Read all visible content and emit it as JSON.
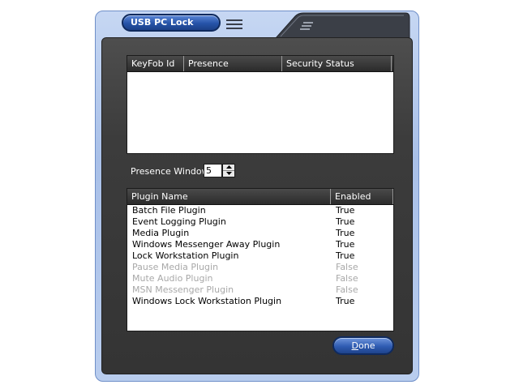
{
  "window": {
    "title": "USB PC Lock"
  },
  "keyfob_table": {
    "columns": [
      "KeyFob Id",
      "Presence",
      "Security Status"
    ],
    "rows": []
  },
  "presence": {
    "label": "Presence Window",
    "value": "5"
  },
  "plugin_table": {
    "columns": [
      "Plugin Name",
      "Enabled"
    ],
    "rows": [
      {
        "name": "Batch File Plugin",
        "enabled": "True"
      },
      {
        "name": "Event Logging Plugin",
        "enabled": "True"
      },
      {
        "name": "Media Plugin",
        "enabled": "True"
      },
      {
        "name": "Windows Messenger Away Plugin",
        "enabled": "True"
      },
      {
        "name": "Lock Workstation Plugin",
        "enabled": "True"
      },
      {
        "name": "Pause Media Plugin",
        "enabled": "False"
      },
      {
        "name": "Mute Audio Plugin",
        "enabled": "False"
      },
      {
        "name": "MSN Messenger Plugin",
        "enabled": "False"
      },
      {
        "name": "Windows Lock Workstation Plugin",
        "enabled": "True"
      }
    ]
  },
  "buttons": {
    "done_first": "D",
    "done_rest": "one"
  },
  "icons": {
    "menu": "hamburger-menu-icon",
    "grip": "window-grip-icon",
    "spin_up": "arrow-up-icon",
    "spin_down": "arrow-down-icon"
  },
  "colors": {
    "accent": "#2653a8",
    "panel": "#3c3c3c",
    "disabled_text": "#a8a8a8"
  }
}
